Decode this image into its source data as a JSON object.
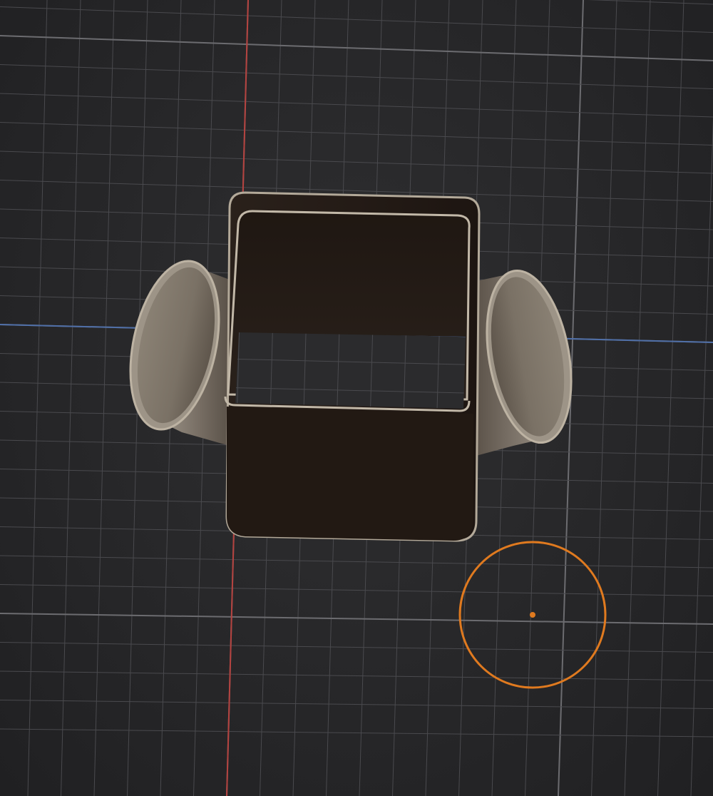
{
  "viewport": {
    "kind": "3d-viewport",
    "background_color": "#262628",
    "grid_color_minor": "#4a4a4e",
    "grid_color_major": "#6c6c70",
    "x_axis_color": "#4f6fa8",
    "y_axis_color": "#b5423f",
    "brush_cursor_color": "#e07a1f"
  },
  "mesh": {
    "name": "square-pipe-with-round-side-openings",
    "material_color_outer": "#8c8276",
    "material_color_inner": "#231a15",
    "material_color_rim": "#b3a999"
  }
}
